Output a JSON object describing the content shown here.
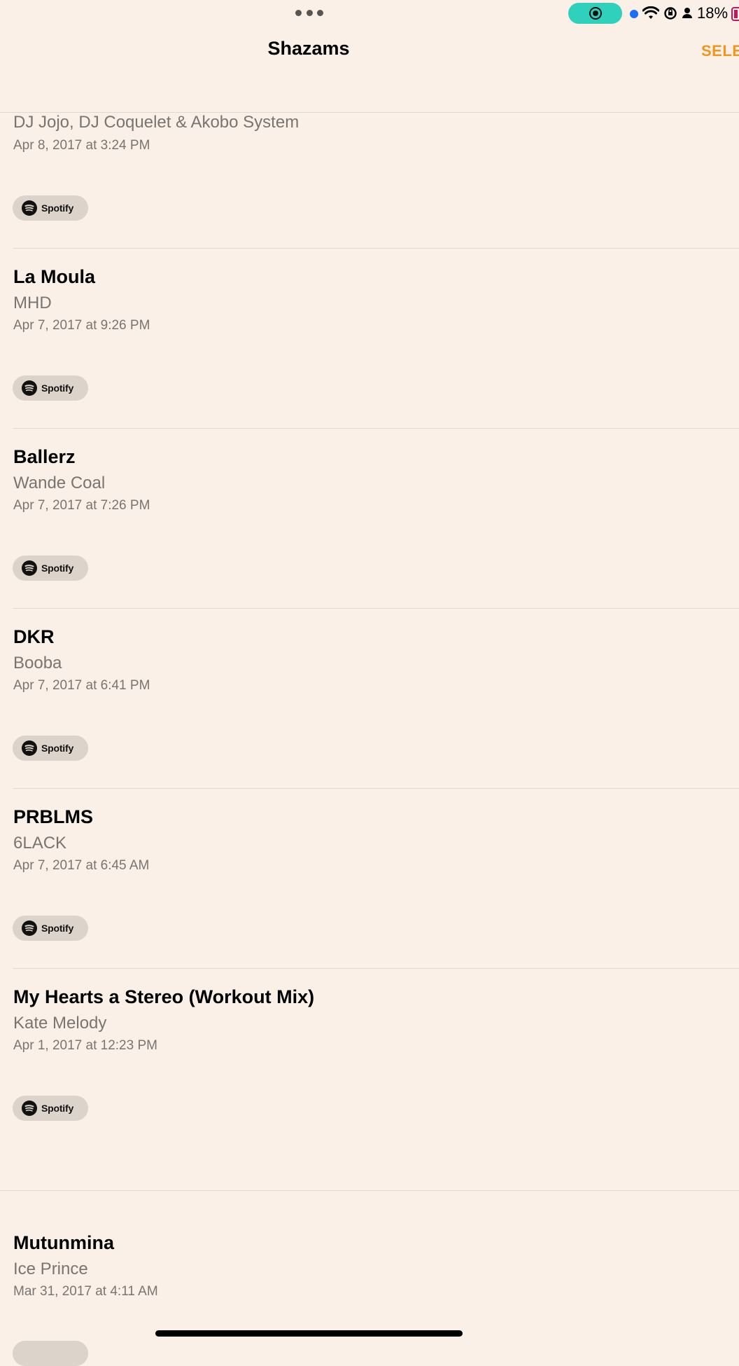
{
  "status_bar": {
    "battery_percent": "18%",
    "recording_indicator": "screen-record-icon",
    "icons": [
      "more-dots-icon",
      "wifi-icon",
      "orientation-lock-icon",
      "person-icon",
      "battery-icon"
    ]
  },
  "header": {
    "title": "Shazams",
    "select_label": "SELECT"
  },
  "colors": {
    "background": "#faf0e7",
    "accent": "#f0961e",
    "record_pill": "#2fd1bd",
    "secondary_text": "#7a7470"
  },
  "spotify_label": "Spotify",
  "items": [
    {
      "title": "",
      "artist": "DJ Jojo, DJ Coquelet & Akobo System",
      "date": "Apr 8, 2017 at 3:24 PM"
    },
    {
      "title": "La Moula",
      "artist": "MHD",
      "date": "Apr 7, 2017 at 9:26 PM"
    },
    {
      "title": "Ballerz",
      "artist": "Wande Coal",
      "date": "Apr 7, 2017 at 7:26 PM"
    },
    {
      "title": "DKR",
      "artist": "Booba",
      "date": "Apr 7, 2017 at 6:41 PM"
    },
    {
      "title": "PRBLMS",
      "artist": "6LACK",
      "date": "Apr 7, 2017 at 6:45 AM"
    },
    {
      "title": "My Hearts a Stereo (Workout Mix)",
      "artist": "Kate Melody",
      "date": "Apr 1, 2017 at 12:23 PM"
    },
    {
      "title": "Mutunmina",
      "artist": "Ice Prince",
      "date": "Mar 31, 2017 at 4:11 AM"
    }
  ]
}
